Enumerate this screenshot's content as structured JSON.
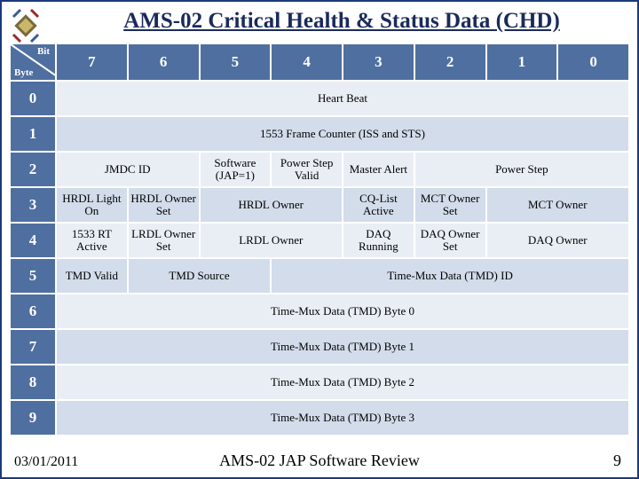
{
  "title": "AMS-02 Critical Health & Status Data (CHD)",
  "header": {
    "bit": "Bit",
    "byte": "Byte",
    "cols": [
      "7",
      "6",
      "5",
      "4",
      "3",
      "2",
      "1",
      "0"
    ]
  },
  "rows": {
    "r0": {
      "idx": "0",
      "full": "Heart Beat"
    },
    "r1": {
      "idx": "1",
      "full": "1553 Frame Counter (ISS and STS)"
    },
    "r2": {
      "idx": "2",
      "jmdc": "JMDC ID",
      "sw": "Software (JAP=1)",
      "psv": "Power Step Valid",
      "ma": "Master Alert",
      "ps": "Power Step"
    },
    "r3": {
      "idx": "3",
      "hlo": "HRDL Light On",
      "hos": "HRDL Owner Set",
      "ho": "HRDL Owner",
      "cq": "CQ-List Active",
      "mos": "MCT Owner Set",
      "mo": "MCT Owner"
    },
    "r4": {
      "idx": "4",
      "ra": "1533 RT Active",
      "los": "LRDL Owner Set",
      "lo": "LRDL Owner",
      "dr": "DAQ Running",
      "dos": "DAQ Owner Set",
      "do": "DAQ Owner"
    },
    "r5": {
      "idx": "5",
      "tv": "TMD Valid",
      "ts": "TMD Source",
      "tmd": "Time-Mux Data (TMD) ID"
    },
    "r6": {
      "idx": "6",
      "full": "Time-Mux Data (TMD) Byte 0"
    },
    "r7": {
      "idx": "7",
      "full": "Time-Mux Data (TMD) Byte 1"
    },
    "r8": {
      "idx": "8",
      "full": "Time-Mux Data (TMD) Byte 2"
    },
    "r9": {
      "idx": "9",
      "full": "Time-Mux Data (TMD) Byte 3"
    }
  },
  "footer": {
    "date": "03/01/2011",
    "center": "AMS-02 JAP Software Review",
    "page": "9"
  }
}
